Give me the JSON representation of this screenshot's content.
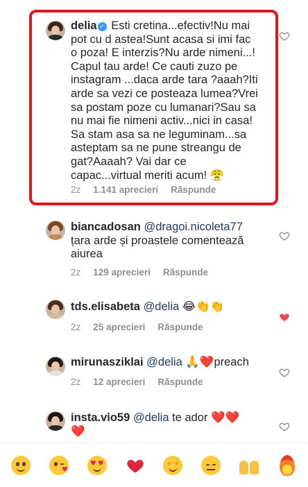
{
  "comments": [
    {
      "username": "delia",
      "verified": true,
      "text_lines": [
        "Esti cretina...efectiv!Nu mai",
        "pot cu d astea!Sunt acasa si imi fac",
        "o poza! E interzis?Nu arde nimeni...!",
        "Capul tau arde! Ce cauti zuzo pe",
        "instagram ...daca arde tara ?aaah?Iti",
        "arde sa vezi ce posteaza lumea?Vrei",
        "sa postam poze cu lumanari?Sau sa",
        "nu mai fie nimeni activ...nici in casa!",
        "Sa stam asa sa ne leguminam...sa",
        "asteptam sa ne pune streangu de",
        "gat?Aaaah? Vai dar ce",
        "capac...virtual meriti acum! 😤"
      ],
      "time": "2z",
      "likes": "1.141 aprecieri",
      "reply": "Răspunde",
      "liked": false
    },
    {
      "username": "biancadosan",
      "mention": "@dragoi.nicoleta77",
      "text_lines": [
        "țara arde și proastele comentează",
        "aiurea"
      ],
      "time": "2z",
      "likes": "129 aprecieri",
      "reply": "Răspunde",
      "liked": false
    },
    {
      "username": "tds.elisabeta",
      "mention": "@delia",
      "text": "😂👏👏",
      "time": "2z",
      "likes": "25 aprecieri",
      "reply": "Răspunde",
      "liked": true
    },
    {
      "username": "mirunasziklai",
      "mention": "@delia",
      "text": "🙏❤️preach",
      "time": "2z",
      "likes": "12 aprecieri",
      "reply": "Răspunde",
      "liked": false
    },
    {
      "username": "insta.vio59",
      "mention": "@delia",
      "text": "te ador ❤️❤️",
      "text_line2": "❤️",
      "liked": false
    }
  ],
  "quick_emojis": [
    "hugging-face",
    "face-blowing-kiss",
    "heart-eyes",
    "red-heart",
    "star-struck",
    "pensive-face",
    "raising-hands",
    "fire"
  ],
  "colors": {
    "highlight_border": "#e0151f",
    "like_red": "#ed4956",
    "meta_gray": "#8e8e8e",
    "verified_blue": "#3897f0"
  }
}
